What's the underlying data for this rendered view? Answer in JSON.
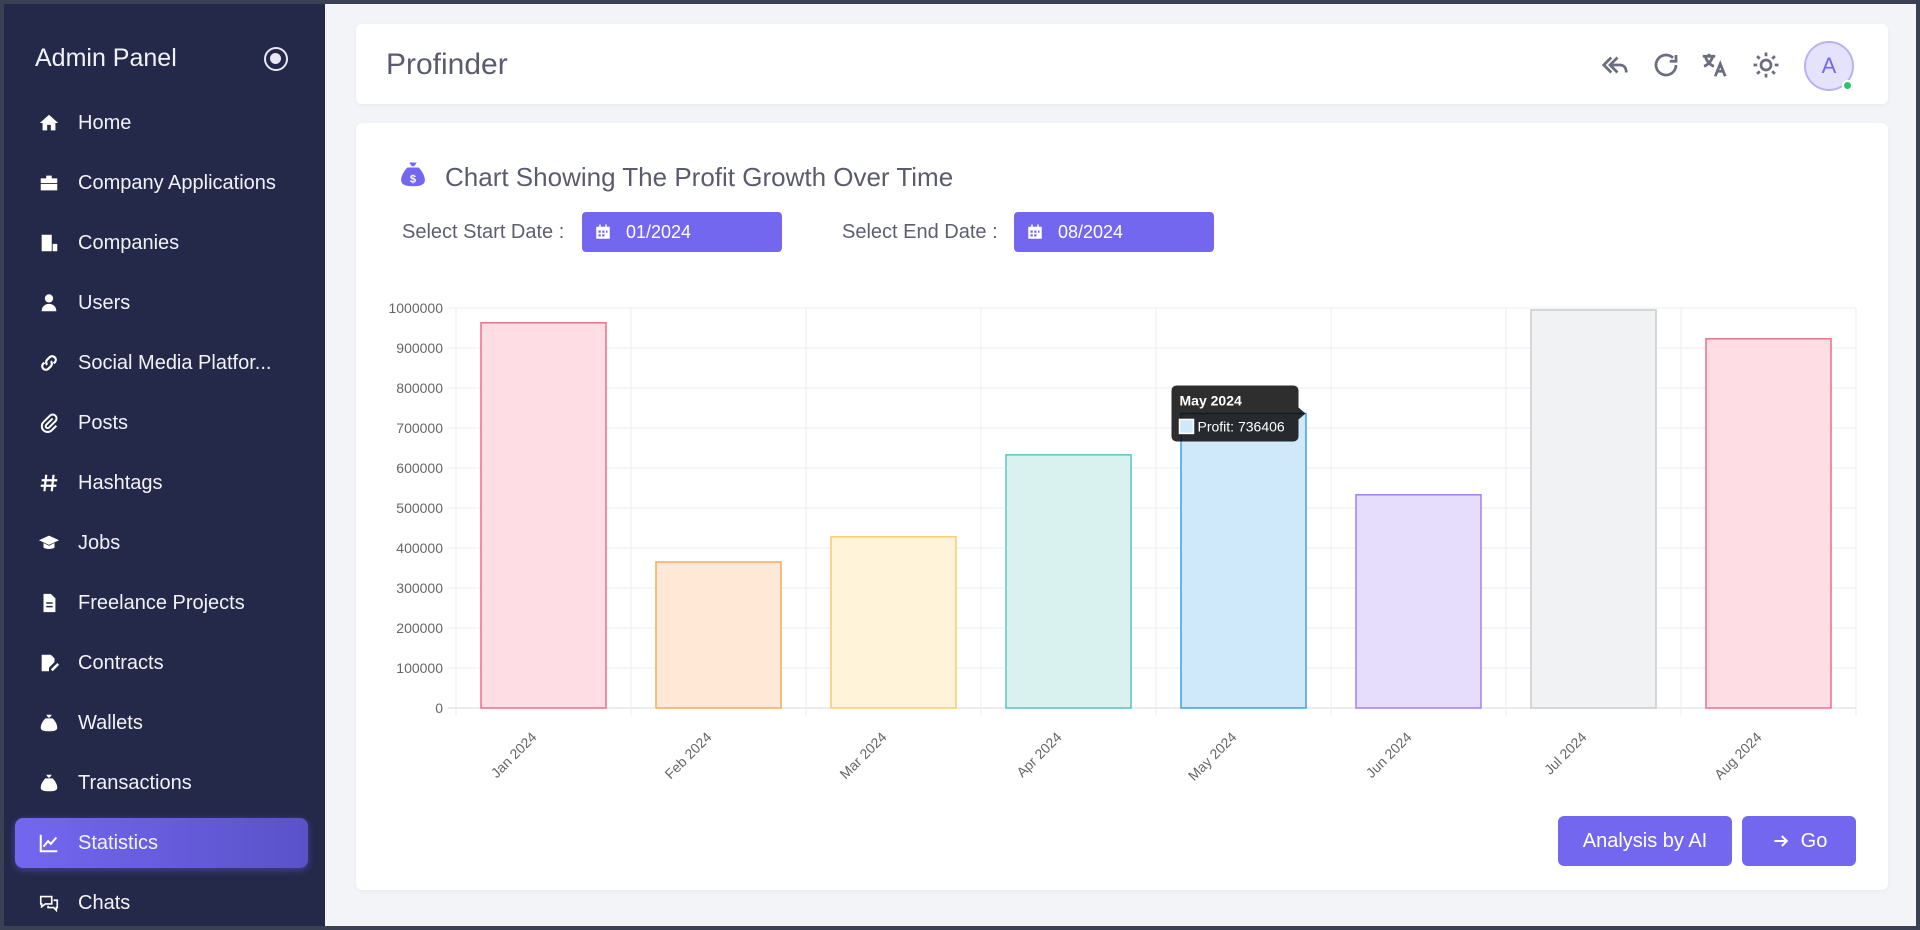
{
  "sidebar": {
    "title": "Admin Panel",
    "items": [
      {
        "label": "Home",
        "icon": "home-icon"
      },
      {
        "label": "Company Applications",
        "icon": "briefcase-icon"
      },
      {
        "label": "Companies",
        "icon": "building-icon"
      },
      {
        "label": "Users",
        "icon": "user-icon"
      },
      {
        "label": "Social Media Platfor...",
        "icon": "link-icon"
      },
      {
        "label": "Posts",
        "icon": "paperclip-icon"
      },
      {
        "label": "Hashtags",
        "icon": "hashtag-icon"
      },
      {
        "label": "Jobs",
        "icon": "graduation-cap-icon"
      },
      {
        "label": "Freelance Projects",
        "icon": "file-icon"
      },
      {
        "label": "Contracts",
        "icon": "signature-icon"
      },
      {
        "label": "Wallets",
        "icon": "money-bag-icon"
      },
      {
        "label": "Transactions",
        "icon": "money-bag-icon"
      },
      {
        "label": "Statistics",
        "icon": "chart-line-icon",
        "active": true
      },
      {
        "label": "Chats",
        "icon": "chat-icon"
      }
    ]
  },
  "header": {
    "title": "Profinder",
    "avatar_letter": "A",
    "status_color": "#28c76f"
  },
  "main": {
    "title": "Chart Showing The Profit Growth Over Time",
    "start_label": "Select Start Date :",
    "start_value": "01/2024",
    "end_label": "Select End Date :",
    "end_value": "08/2024",
    "ai_button": "Analysis by AI",
    "go_button": "Go",
    "accent_color": "#7367f0"
  },
  "tooltip": {
    "title": "May 2024",
    "body": "Profit: 736406"
  },
  "chart_data": {
    "type": "bar",
    "categories": [
      "Jan 2024",
      "Feb 2024",
      "Mar 2024",
      "Apr 2024",
      "May 2024",
      "Jun 2024",
      "Jul 2024",
      "Aug 2024"
    ],
    "series": [
      {
        "name": "Profit",
        "values": [
          963000,
          365000,
          428000,
          633000,
          736406,
          533000,
          995000,
          923000
        ]
      }
    ],
    "ylim": [
      0,
      1000000
    ],
    "yticks": [
      "0",
      "100000",
      "200000",
      "300000",
      "400000",
      "500000",
      "600000",
      "700000",
      "800000",
      "900000",
      "1000000"
    ],
    "grid": true,
    "fills": [
      "#ffdde4",
      "#ffe9d6",
      "#fff3d9",
      "#d9f2ef",
      "#cfe9fb",
      "#e6ddfd",
      "#f1f2f3",
      "#ffdde4"
    ],
    "strokes": [
      "#ef6d8a",
      "#f5aa5d",
      "#f7cc6c",
      "#5cc3c1",
      "#3ea1e2",
      "#a27ff3",
      "#c9cbcf",
      "#ef6d8a"
    ]
  }
}
